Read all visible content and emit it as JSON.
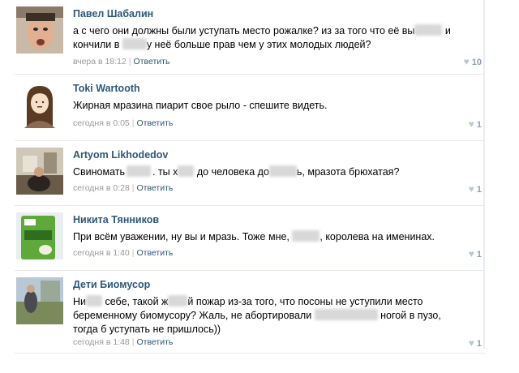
{
  "comments": [
    {
      "author": "Павел Шабалин",
      "avatar": "avatar-photo-man",
      "parts": [
        "а с чего они должны были уступать место рожалке? из за того что её вы",
        "",
        " и",
        "кончили в ",
        "",
        "у неё больше прав чем у этих молодых людей?"
      ],
      "time": "вчера в 18:12",
      "reply": "Ответить",
      "likes": "10"
    },
    {
      "author": "Toki Wartooth",
      "avatar": "avatar-drawing-girl",
      "parts": [
        "Жирная мразина пиарит свое рыло - спешите видеть."
      ],
      "time": "сегодня в 0:05",
      "reply": "Ответить",
      "likes": "1"
    },
    {
      "author": "Artyom Likhodedov",
      "avatar": "avatar-photo-room",
      "parts": [
        "Свиномать",
        "",
        ". ты х",
        "",
        " до человека до",
        "",
        "ь, мразота брюхатая?"
      ],
      "time": "сегодня в 0:28",
      "reply": "Ответить",
      "likes": "1"
    },
    {
      "author": "Никита Тянников",
      "avatar": "avatar-photo-green-pack",
      "parts": [
        "При всём уважении, ну вы и мразь. Тоже мне, ",
        "",
        ", королева на именинах."
      ],
      "time": "сегодня в 1:40",
      "reply": "Ответить",
      "likes": "1"
    },
    {
      "author": "Дети Биомусор",
      "avatar": "avatar-photo-outdoor",
      "parts": [
        "Ни",
        "",
        " себе, такой ж",
        "",
        "й пожар из-за того, что посоны не уступили место",
        "беременному биомусору? Жаль, не абортировали ",
        "",
        " ногой в пузо,",
        "тогда б уступать не пришлось))"
      ],
      "time": "сегодня в 1:48",
      "reply": "Ответить",
      "likes": "1"
    }
  ],
  "separator": "|",
  "icons": {
    "like": "heart-icon"
  },
  "colors": {
    "author": "#2b587a",
    "meta": "#999999",
    "likes": "#8ba0b6",
    "divider": "#e4e8ed"
  }
}
